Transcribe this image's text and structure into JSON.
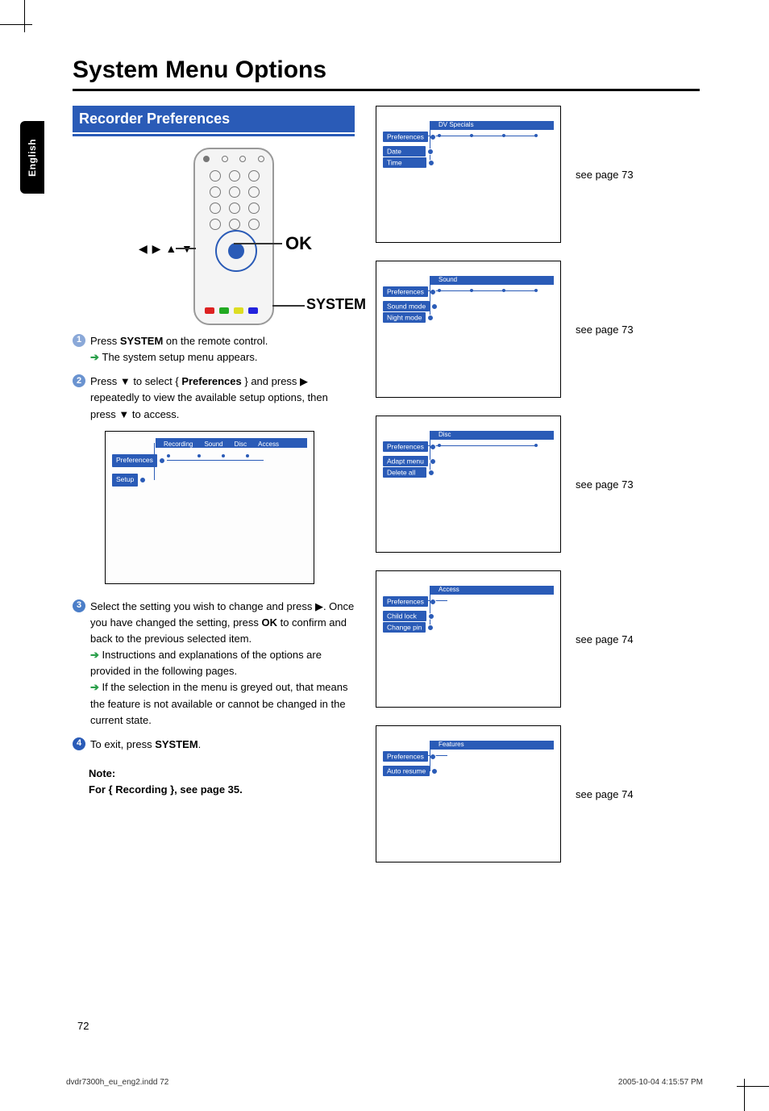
{
  "side_tab": "English",
  "chapter_title": "System Menu Options",
  "section_title": "Recorder Preferences",
  "remote_labels": {
    "arrows": "◀ ▶ ▲ ▼",
    "ok": "OK",
    "system": "SYSTEM"
  },
  "steps": {
    "s1_a": "Press ",
    "s1_b": "SYSTEM",
    "s1_c": " on the remote control.",
    "s1_sub": "The system setup menu appears.",
    "s2_a": "Press ▼ to select { ",
    "s2_b": "Preferences",
    "s2_c": " } and press ▶ repeatedly to view the available setup options, then press ▼ to access.",
    "s3_a": "Select the setting you wish to change and press ▶. Once you have changed the setting, press ",
    "s3_b": "OK",
    "s3_c": " to confirm and back to the previous selected item.",
    "s3_sub1": "Instructions and explanations of the options are provided in the following pages.",
    "s3_sub2": "If the selection in the menu is greyed out, that means the feature is not available or cannot be changed in the current state.",
    "s4_a": "To exit, press ",
    "s4_b": "SYSTEM",
    "s4_c": "."
  },
  "left_menu": {
    "top_tabs": [
      "Recording",
      "Sound",
      "Disc",
      "Access"
    ],
    "rows": [
      "Preferences",
      "Setup"
    ]
  },
  "right_menus": [
    {
      "tab": "DV Specials",
      "pref": "Preferences",
      "items": [
        "Date",
        "Time"
      ],
      "see": "see page 73"
    },
    {
      "tab": "Sound",
      "pref": "Preferences",
      "items": [
        "Sound mode",
        "Night mode"
      ],
      "see": "see page 73"
    },
    {
      "tab": "Disc",
      "pref": "Preferences",
      "items": [
        "Adapt menu",
        "Delete all"
      ],
      "see": "see page 73"
    },
    {
      "tab": "Access",
      "pref": "Preferences",
      "items": [
        "Child lock",
        "Change pin"
      ],
      "see": "see page 74"
    },
    {
      "tab": "Features",
      "pref": "Preferences",
      "items": [
        "Auto resume"
      ],
      "see": "see page 74"
    }
  ],
  "note": {
    "label": "Note:",
    "text": "For { Recording }, see page 35."
  },
  "page_number": "72",
  "footer_left": "dvdr7300h_eu_eng2.indd   72",
  "footer_right": "2005-10-04   4:15:57 PM"
}
